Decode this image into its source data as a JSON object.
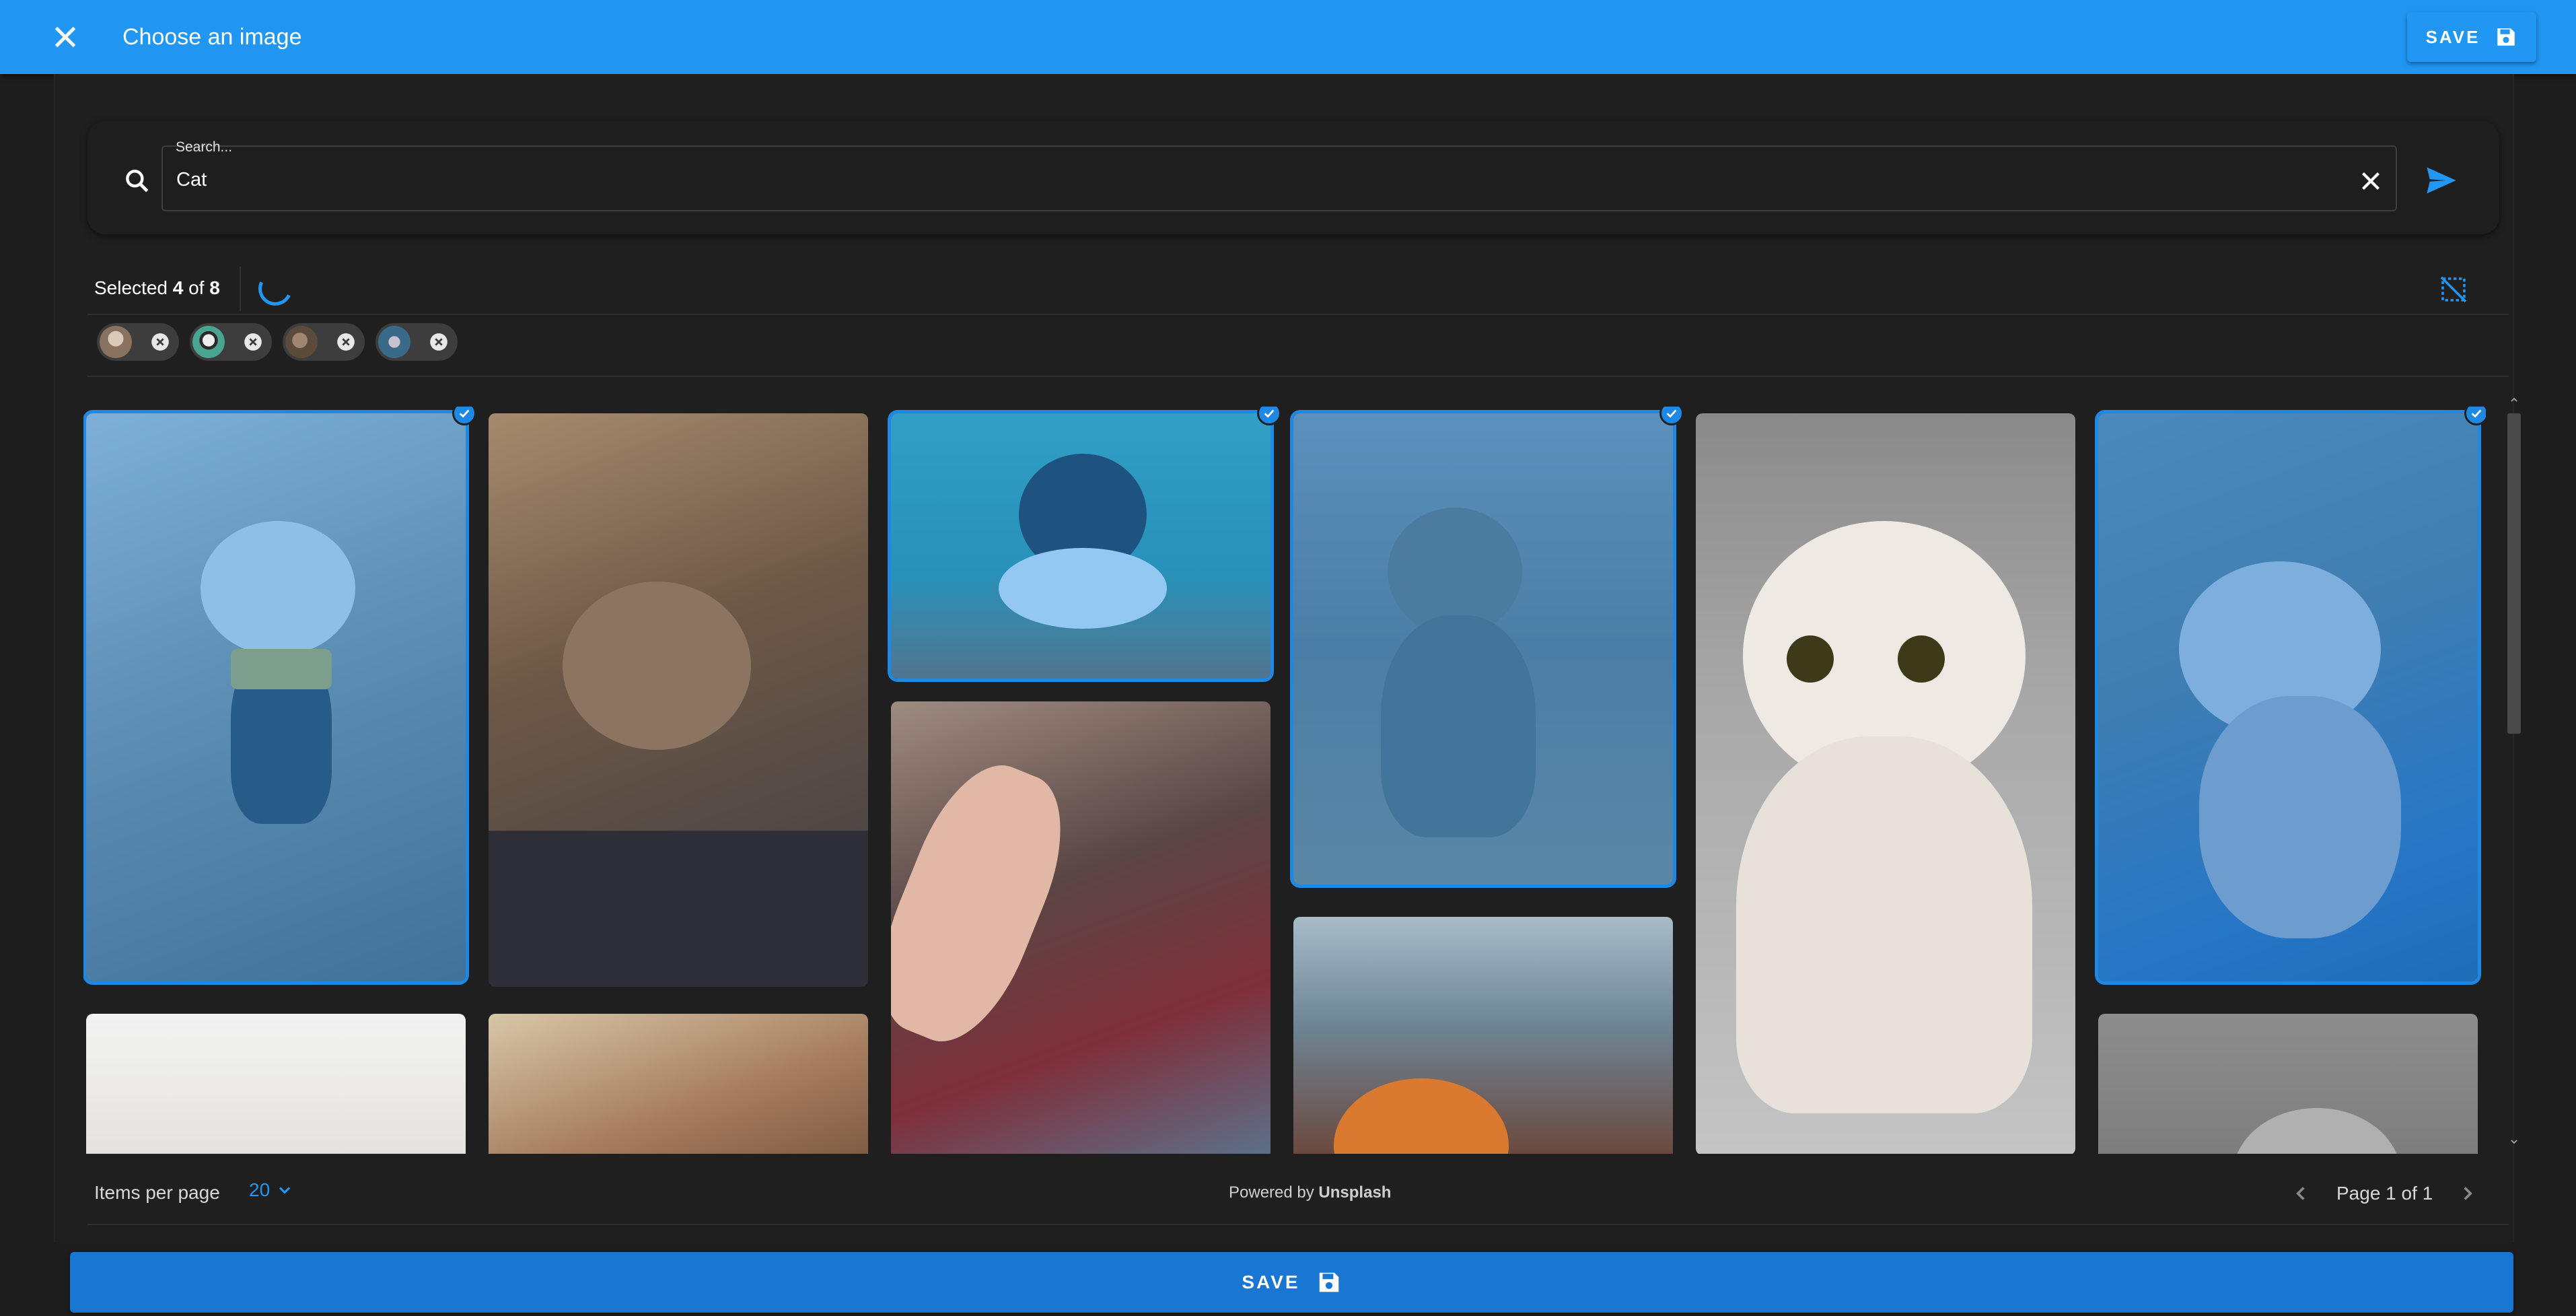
{
  "header": {
    "title": "Choose an image",
    "save_label": "SAVE",
    "close_icon": "close-icon",
    "save_icon": "floppy-disk-icon"
  },
  "search": {
    "floating_label": "Search...",
    "value": "Cat",
    "search_icon": "search-icon",
    "clear_icon": "clear-icon",
    "submit_icon": "send-icon"
  },
  "selection": {
    "prefix": "Selected",
    "count": "4",
    "of_word": "of",
    "total": "8",
    "loading": true,
    "deselect_icon": "deselect-icon",
    "chips": [
      {
        "name": "selected-chip-1",
        "thumb": "cat-smiling"
      },
      {
        "name": "selected-chip-2",
        "thumb": "cat-teal-box"
      },
      {
        "name": "selected-chip-3",
        "thumb": "cat-yawning"
      },
      {
        "name": "selected-chip-4",
        "thumb": "cat-butterfly"
      }
    ]
  },
  "gallery": {
    "images": [
      {
        "name": "image-cat-smiling-bandana",
        "selected": true
      },
      {
        "name": "image-tabby-cat-lying",
        "selected": false
      },
      {
        "name": "image-cat-in-box",
        "selected": true
      },
      {
        "name": "image-kitten-yawning",
        "selected": true
      },
      {
        "name": "image-white-kitten-surprised",
        "selected": false
      },
      {
        "name": "image-cat-with-butterfly",
        "selected": true
      },
      {
        "name": "image-cat-under-blanket",
        "selected": false
      },
      {
        "name": "image-cat-in-knit-hat",
        "selected": false
      },
      {
        "name": "image-human-hand-cat-paw",
        "selected": false
      },
      {
        "name": "image-ginger-cat",
        "selected": false
      },
      {
        "name": "image-gray-cat-grayscale",
        "selected": false
      }
    ]
  },
  "pagination": {
    "items_per_page_label": "Items per page",
    "items_per_page_value": "20",
    "powered_by_prefix": "Powered by",
    "powered_by_brand": "Unsplash",
    "page_text": "Page 1 of 1",
    "prev_icon": "chevron-left-icon",
    "next_icon": "chevron-right-icon"
  },
  "footer": {
    "save_label": "SAVE"
  },
  "colors": {
    "primary": "#2196f3",
    "primary_dark": "#1976d2",
    "background": "#1f1f1f"
  }
}
